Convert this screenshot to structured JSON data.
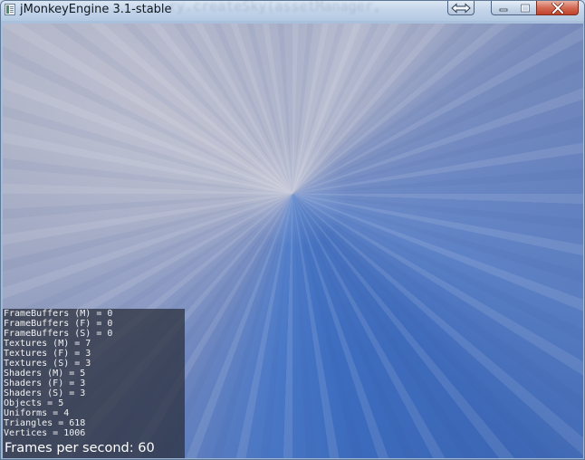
{
  "window": {
    "title": "jMonkeyEngine 3.1-stable",
    "ghost_text": "ry.createSky(assetManager,"
  },
  "titlebar_buttons": [
    {
      "name": "resize",
      "icon": "double-arrow-icon"
    },
    {
      "name": "minimize",
      "icon": "minimize-icon"
    },
    {
      "name": "maximize",
      "icon": "maximize-icon"
    },
    {
      "name": "close",
      "icon": "close-icon"
    }
  ],
  "stats": {
    "lines": [
      "FrameBuffers (M) = 0",
      "FrameBuffers (F) = 0",
      "FrameBuffers (S) = 0",
      "Textures (M) = 7",
      "Textures (F) = 3",
      "Textures (S) = 3",
      "Shaders (M) = 5",
      "Shaders (F) = 3",
      "Shaders (S) = 3",
      "Objects = 5",
      "Uniforms = 4",
      "Triangles = 618",
      "Vertices = 1006"
    ],
    "fps_text": "Frames per second: 60"
  },
  "colors": {
    "sky_light": "#b9bdcf",
    "sky_deep": "#3d6cbf",
    "stats_background": "#282c38",
    "close_button": "#c0412b"
  }
}
